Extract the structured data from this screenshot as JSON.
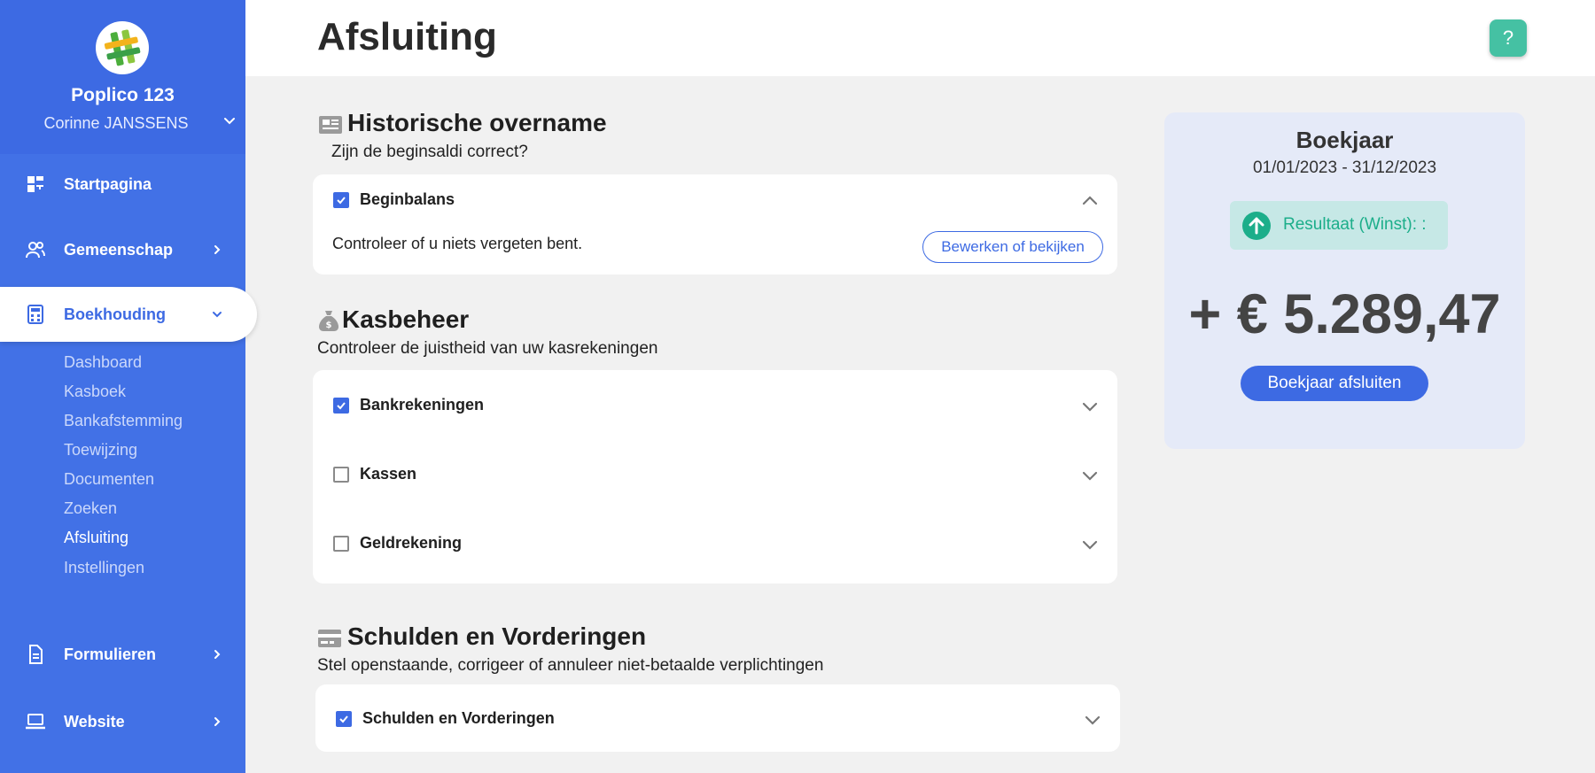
{
  "sidebar": {
    "org_name": "Poplico 123",
    "user_name": "Corinne JANSSENS",
    "nav": {
      "home": "Startpagina",
      "community": "Gemeenschap",
      "accounting": "Boekhouding",
      "forms": "Formulieren",
      "website": "Website"
    },
    "sub_items": [
      "Dashboard",
      "Kasboek",
      "Bankafstemming",
      "Toewijzing",
      "Documenten",
      "Zoeken",
      "Afsluiting",
      "Instellingen"
    ],
    "current_sub": "Afsluiting"
  },
  "header": {
    "title": "Afsluiting",
    "help_label": "?"
  },
  "sections": {
    "historical": {
      "title": "Historische overname",
      "subtitle": "Zijn de beginsaldi correct?",
      "row_label": "Beginbalans",
      "row_checked": true,
      "body_text": "Controleer of u niets vergeten bent.",
      "button_label": "Bewerken of bekijken"
    },
    "cash": {
      "title": "Kasbeheer",
      "subtitle": "Controleer de juistheid van uw kasrekeningen",
      "rows": [
        {
          "label": "Bankrekeningen",
          "checked": true
        },
        {
          "label": "Kassen",
          "checked": false
        },
        {
          "label": "Geldrekening",
          "checked": false
        }
      ]
    },
    "debts": {
      "title": "Schulden en Vorderingen",
      "subtitle": "Stel openstaande, corrigeer of annuleer niet-betaalde verplichtingen",
      "row_label": "Schulden en Vorderingen",
      "row_checked": true
    }
  },
  "fiscal_year": {
    "title": "Boekjaar",
    "range": "01/01/2023 - 31/12/2023",
    "result_label": "Resultaat (Winst): :",
    "amount": "+ € 5.289,47",
    "close_button": "Boekjaar afsluiten"
  },
  "colors": {
    "primary": "#3d6ae3",
    "sidebar": "#4271e6",
    "accent_green": "#1cae8a",
    "help_button": "#45c1a3"
  }
}
